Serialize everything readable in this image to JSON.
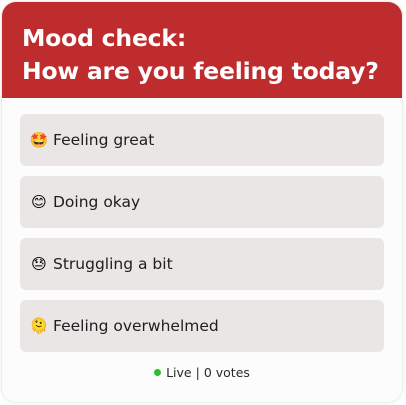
{
  "poll": {
    "title_line1": "Mood check:",
    "title_line2": "How are you feeling today?",
    "options": [
      {
        "emoji": "🤩",
        "label": "Feeling great"
      },
      {
        "emoji": "😊",
        "label": "Doing okay"
      },
      {
        "emoji": "😓",
        "label": "Struggling a bit"
      },
      {
        "emoji": "🫠",
        "label": "Feeling overwhelmed"
      }
    ],
    "status": {
      "live_label": "Live",
      "separator": "|",
      "votes_text": "0 votes"
    }
  },
  "colors": {
    "header": "#bf2c2e",
    "option_bg": "#e9e6e5",
    "live_dot": "#2bbf2b"
  }
}
